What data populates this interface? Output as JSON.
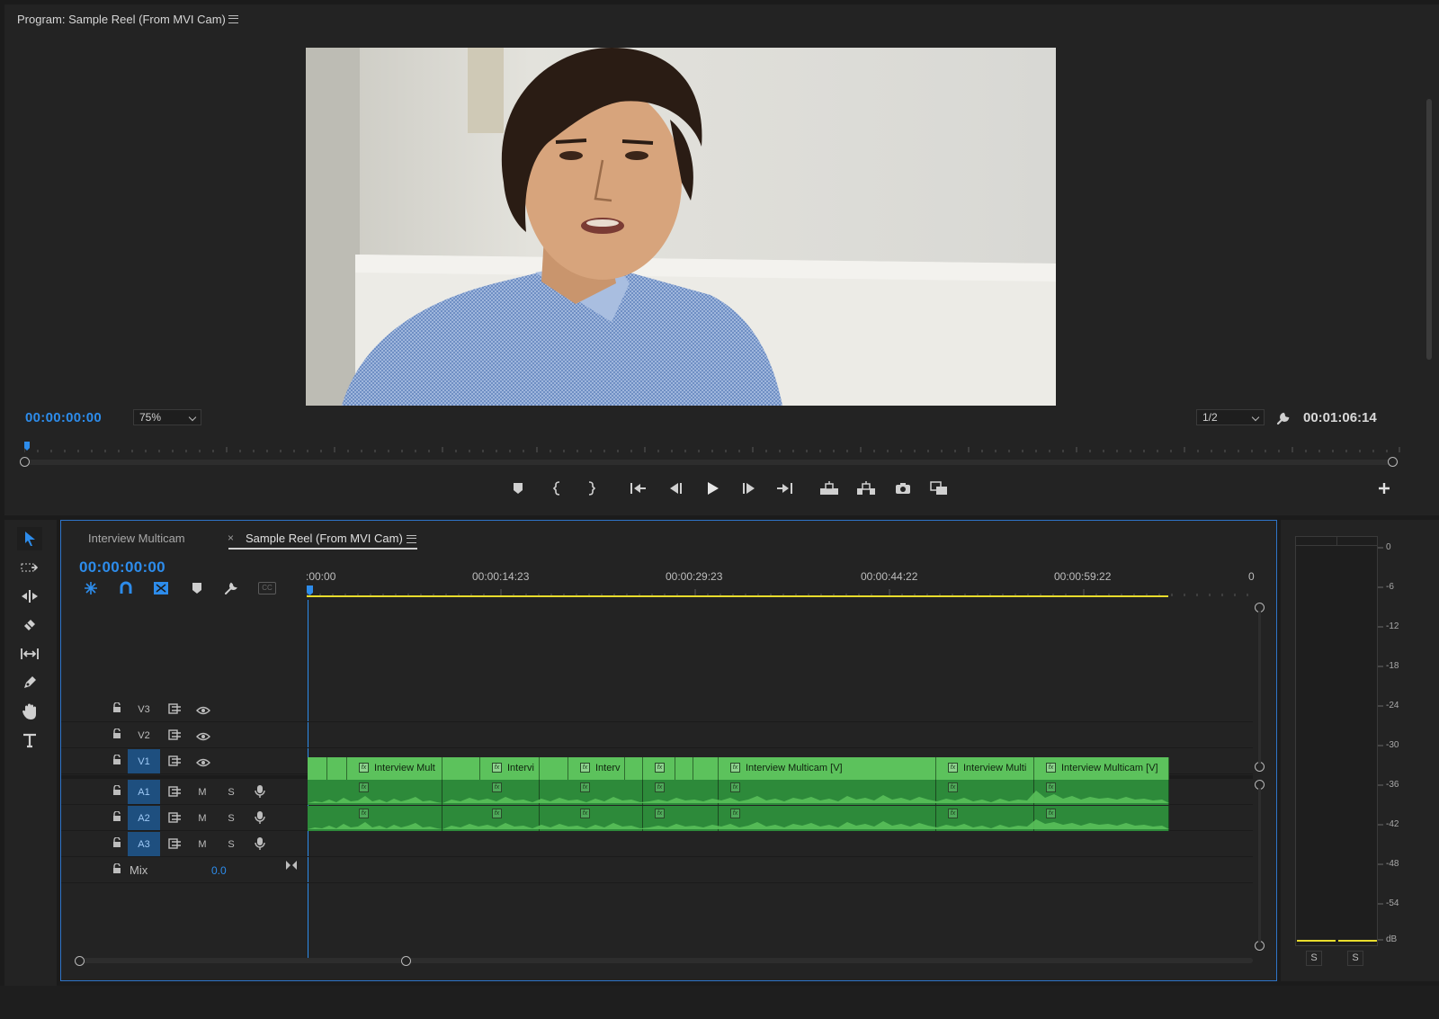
{
  "program_monitor": {
    "title": "Program: Sample Reel (From MVI Cam)",
    "timecode_current": "00:00:00:00",
    "zoom_select": "75%",
    "resolution_select": "1/2",
    "timecode_duration": "00:01:06:14"
  },
  "timeline": {
    "tabs": [
      {
        "label": "Interview Multicam",
        "active": false
      },
      {
        "label": "Sample Reel (From MVI Cam)",
        "active": true
      }
    ],
    "timecode": "00:00:00:00",
    "ruler_labels": [
      ":00:00",
      "00:00:14:23",
      "00:00:29:23",
      "00:00:44:22",
      "00:00:59:22",
      "0"
    ],
    "tracks": {
      "video": [
        {
          "label": "V3"
        },
        {
          "label": "V2"
        },
        {
          "label": "V1"
        }
      ],
      "audio": [
        {
          "label": "A1"
        },
        {
          "label": "A2"
        },
        {
          "label": "A3"
        }
      ],
      "mix_label": "Mix",
      "mix_value": "0.0",
      "mute_label": "M",
      "solo_label": "S"
    },
    "video_clips": [
      {
        "label": ""
      },
      {
        "label": "Interview Mult"
      },
      {
        "label": ""
      },
      {
        "label": "Intervi"
      },
      {
        "label": "Interv"
      },
      {
        "label": ""
      },
      {
        "label": ""
      },
      {
        "label": "Interview Multicam [V]"
      },
      {
        "label": "Interview Multi"
      },
      {
        "label": "Interview Multicam [V]"
      }
    ]
  },
  "audio_meter": {
    "scale": [
      "0",
      "-6",
      "-12",
      "-18",
      "-24",
      "-30",
      "-36",
      "-42",
      "-48",
      "-54",
      "dB"
    ],
    "solo_buttons": [
      "S",
      "S"
    ]
  },
  "colors": {
    "accent_blue": "#2d8ceb",
    "clip_video": "#5cc25c",
    "clip_audio": "#2d8a3a",
    "work_area": "#e8dc2c"
  }
}
